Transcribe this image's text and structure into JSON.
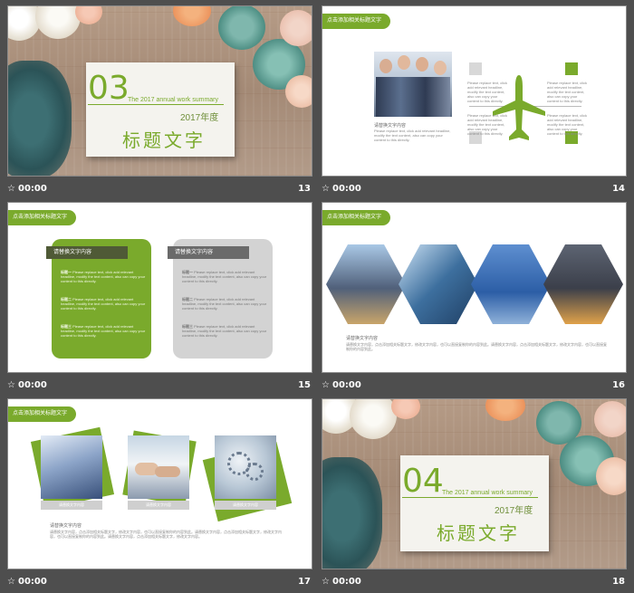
{
  "slides": {
    "s13": {
      "number": "13",
      "time": "00:00",
      "star": "☆",
      "big_number": "03",
      "subtitle": "The 2017 annual work summary",
      "year": "2017年度",
      "title": "标题文字"
    },
    "s14": {
      "number": "14",
      "time": "00:00",
      "star": "☆",
      "tag": "点击添加相关标题文字",
      "caption": "请替换文字内容",
      "para": "Please replace text, click add relevant headline, modify the text content, also can copy your content to this directly.",
      "side_text": "Please replace text, click add relevant headline, modify the text content, also can copy your content to this directly."
    },
    "s15": {
      "number": "15",
      "time": "00:00",
      "star": "☆",
      "tag": "点击添加相关标题文字",
      "card1_header": "请替换文字内容",
      "card2_header": "请替换文字内容",
      "card1_items": [
        "标题一",
        "标题二",
        "标题三"
      ],
      "card2_items": [
        "标题一",
        "标题二",
        "标题三"
      ],
      "item_text": "Please replace text, click add relevant headline, modify the text content, also can copy your content to this directly."
    },
    "s16": {
      "number": "16",
      "time": "00:00",
      "star": "☆",
      "tag": "点击添加相关标题文字",
      "caption": "请替换文字内容",
      "para": "请替换文字内容，点击添加相关标题文字，修改文字内容，也可以直接复制你的内容到此。请替换文字内容，点击添加相关标题文字，修改文字内容，也可以直接复制你的内容到此。"
    },
    "s17": {
      "number": "17",
      "time": "00:00",
      "star": "☆",
      "tag": "点击添加相关标题文字",
      "photo_labels": [
        "请替换文字内容",
        "请替换文字内容",
        "请替换文字内容"
      ],
      "caption": "请替换文字内容",
      "para": "请替换文字内容，点击添加相关标题文字，修改文字内容，也可以直接复制你的内容到此。请替换文字内容，点击添加相关标题文字，修改文字内容，也可以直接复制你的内容到此。请替换文字内容，点击添加相关标题文字，修改文字内容。"
    },
    "s18": {
      "number": "18",
      "time": "00:00",
      "star": "☆",
      "big_number": "04",
      "subtitle": "The 2017 annual work summary",
      "year": "2017年度",
      "title": "标题文字"
    }
  },
  "colors": {
    "accent": "#7aaa2c",
    "background": "#4e4e4e"
  }
}
